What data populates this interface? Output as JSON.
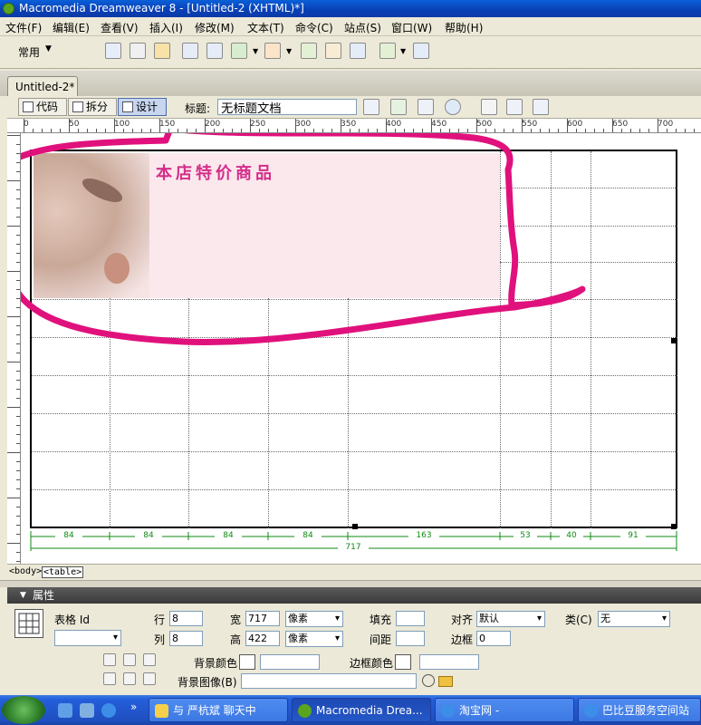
{
  "window": {
    "title": "Macromedia Dreamweaver 8 - [Untitled-2 (XHTML)*]"
  },
  "menu": [
    "文件(F)",
    "编辑(E)",
    "查看(V)",
    "插入(I)",
    "修改(M)",
    "文本(T)",
    "命令(C)",
    "站点(S)",
    "窗口(W)",
    "帮助(H)"
  ],
  "insert_bar": {
    "category": "常用"
  },
  "document": {
    "tab_label": "Untitled-2*",
    "view_buttons": [
      "代码",
      "拆分",
      "设计"
    ],
    "title_label": "标题:",
    "title_value": "无标题文档"
  },
  "ruler": {
    "h_labels": [
      "0",
      "50",
      "100",
      "150",
      "200",
      "250",
      "300",
      "350",
      "400",
      "450",
      "500",
      "550",
      "600",
      "650",
      "700"
    ]
  },
  "page": {
    "banner_text": "本店特价商品",
    "column_widths": [
      "84",
      "84",
      "84",
      "84",
      "163",
      "53",
      "40",
      "91"
    ],
    "table_width": "717"
  },
  "tag_selector": [
    "<body>",
    "<table>"
  ],
  "properties": {
    "header": "属性",
    "table_id_label": "表格 Id",
    "rows_label": "行",
    "rows": "8",
    "cols_label": "列",
    "cols": "8",
    "width_label": "宽",
    "width": "717",
    "width_unit": "像素",
    "height_label": "高",
    "height": "422",
    "height_unit": "像素",
    "padding_label": "填充",
    "padding": "",
    "spacing_label": "间距",
    "spacing": "",
    "align_label": "对齐",
    "align": "默认",
    "border_label": "边框",
    "border": "0",
    "class_label": "类(C)",
    "class_value": "无",
    "bgcolor_label": "背景颜色",
    "bordercolor_label": "边框颜色",
    "bgimage_label": "背景图像(B)"
  },
  "taskbar": {
    "tasks": [
      "与 严杭斌 聊天中",
      "Macromedia Drea...",
      "淘宝网 -",
      "巴比豆服务空间站"
    ]
  },
  "colors": {
    "scribble": "#e0117c",
    "banner_text": "#d42e8a",
    "width_guide": "#118a14"
  }
}
